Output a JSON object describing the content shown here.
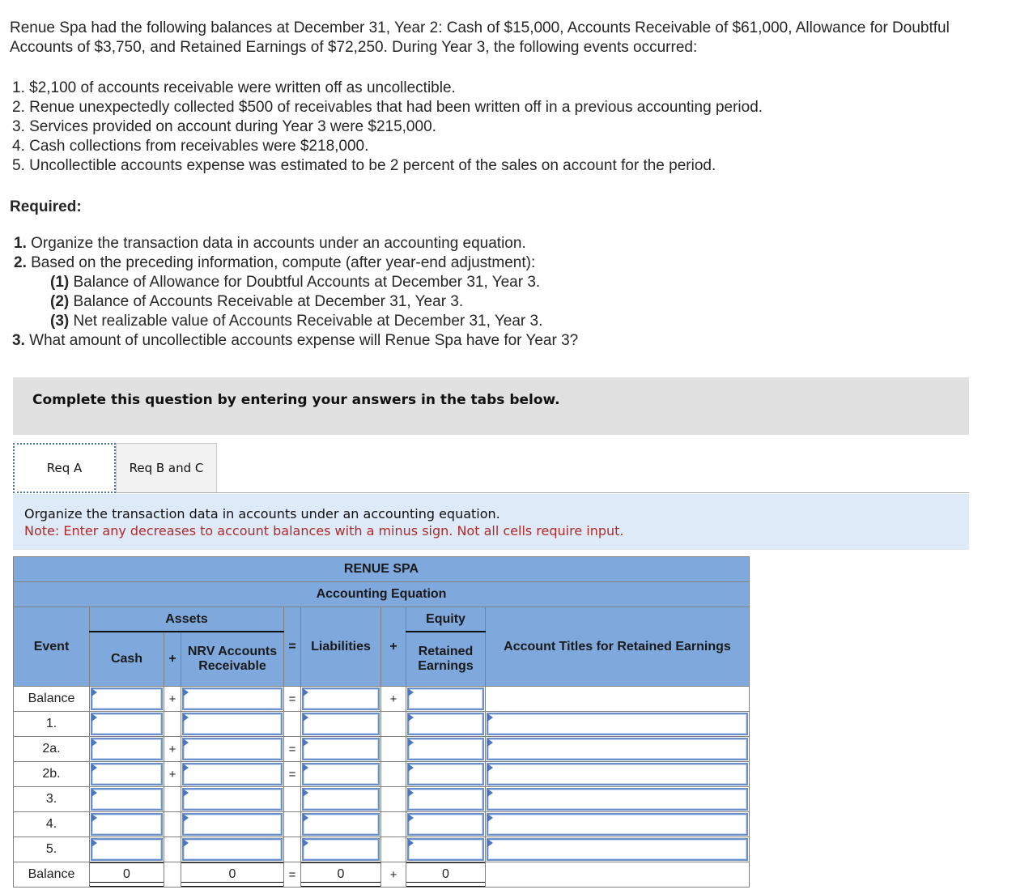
{
  "problem": {
    "intro": "Renue Spa had the following balances at December 31, Year 2: Cash of $15,000, Accounts Receivable of $61,000, Allowance for Doubtful Accounts of $3,750, and Retained Earnings of $72,250. During Year 3, the following events occurred:",
    "events": [
      "1. $2,100 of accounts receivable were written off as uncollectible.",
      "2. Renue unexpectedly collected $500 of receivables that had been written off in a previous accounting period.",
      "3. Services provided on account during Year 3 were $215,000.",
      "4. Cash collections from receivables were $218,000.",
      "5. Uncollectible accounts expense was estimated to be 2 percent of the sales on account for the period."
    ],
    "required_label": "Required:",
    "required": [
      {
        "num": "1.",
        "text": " Organize the transaction data in accounts under an accounting equation."
      },
      {
        "num": "2.",
        "text": " Based on the preceding information, compute (after year-end adjustment):"
      },
      {
        "num": "(1)",
        "text": " Balance of Allowance for Doubtful Accounts at December 31, Year 3."
      },
      {
        "num": "(2)",
        "text": " Balance of Accounts Receivable at December 31, Year 3."
      },
      {
        "num": "(3)",
        "text": " Net realizable value of Accounts Receivable at December 31, Year 3."
      },
      {
        "num": "3.",
        "text": " What amount of uncollectible accounts expense will Renue Spa have for Year 3?"
      }
    ]
  },
  "banner": "Complete this question by entering your answers in the tabs below.",
  "tabs": [
    {
      "label": "Req A",
      "active": true
    },
    {
      "label": "Req B and C",
      "active": false
    }
  ],
  "instructions": {
    "line1": "Organize the transaction data in accounts under an accounting equation.",
    "note": "Note: Enter any decreases to account balances with a minus sign. Not all cells require input."
  },
  "table": {
    "company": "RENUE SPA",
    "title": "Accounting Equation",
    "headers": {
      "event": "Event",
      "assets": "Assets",
      "cash": "Cash",
      "plus": "+",
      "nrv": "NRV Accounts Receivable",
      "equals": "=",
      "liabilities": "Liabilities",
      "equity": "Equity",
      "retained_earnings": "Retained Earnings",
      "account_titles": "Account Titles for Retained Earnings"
    },
    "rows": [
      {
        "event": "Balance",
        "op1": "+",
        "op2": "=",
        "op3": "+",
        "has_title": false
      },
      {
        "event": "1.",
        "op1": "",
        "op2": "",
        "op3": "",
        "has_title": true
      },
      {
        "event": "2a.",
        "op1": "+",
        "op2": "=",
        "op3": "",
        "has_title": true
      },
      {
        "event": "2b.",
        "op1": "+",
        "op2": "=",
        "op3": "",
        "has_title": true
      },
      {
        "event": "3.",
        "op1": "",
        "op2": "",
        "op3": "",
        "has_title": true
      },
      {
        "event": "4.",
        "op1": "",
        "op2": "",
        "op3": "",
        "has_title": true
      },
      {
        "event": "5.",
        "op1": "",
        "op2": "",
        "op3": "",
        "has_title": true
      }
    ],
    "totals": {
      "event": "Balance",
      "cash": "0",
      "op1": "",
      "nrv": "0",
      "op2": "=",
      "liabilities": "0",
      "op3": "+",
      "retained_earnings": "0"
    }
  }
}
